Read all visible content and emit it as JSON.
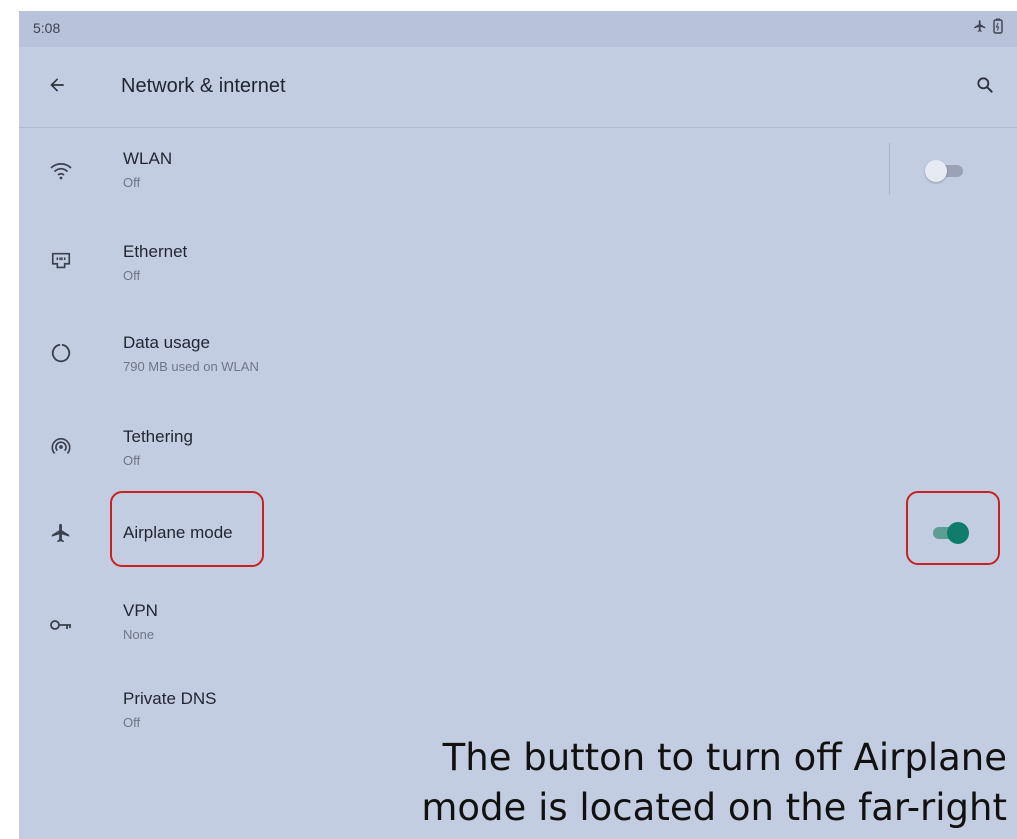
{
  "status_bar": {
    "time": "5:08",
    "icons": [
      "airplane-icon",
      "battery-icon"
    ]
  },
  "app_bar": {
    "title": "Network & internet",
    "back_icon": "arrow-left-icon",
    "search_icon": "search-icon"
  },
  "settings": [
    {
      "title": "WLAN",
      "subtitle": "Off",
      "icon": "wifi-icon",
      "toggle": "off"
    },
    {
      "title": "Ethernet",
      "subtitle": "Off",
      "icon": "ethernet-icon"
    },
    {
      "title": "Data usage",
      "subtitle": "790 MB used on WLAN",
      "icon": "data-usage-icon"
    },
    {
      "title": "Tethering",
      "subtitle": "Off",
      "icon": "hotspot-icon"
    },
    {
      "title": "Airplane mode",
      "subtitle": "",
      "icon": "airplane-icon",
      "toggle": "on"
    },
    {
      "title": "VPN",
      "subtitle": "None",
      "icon": "vpn-key-icon"
    },
    {
      "title": "Private DNS",
      "subtitle": "Off",
      "icon": ""
    }
  ],
  "colors": {
    "toggle_on_thumb": "#0f7d6b",
    "toggle_on_track": "#5c9e93",
    "toggle_off_thumb": "#e6eaf2",
    "toggle_off_track": "#9aa3b6",
    "highlight": "#c8211f",
    "screen_background": "#c3cde2"
  },
  "annotation": {
    "line1": "The button to turn off Airplane",
    "line2": "mode is located on the far-right"
  }
}
